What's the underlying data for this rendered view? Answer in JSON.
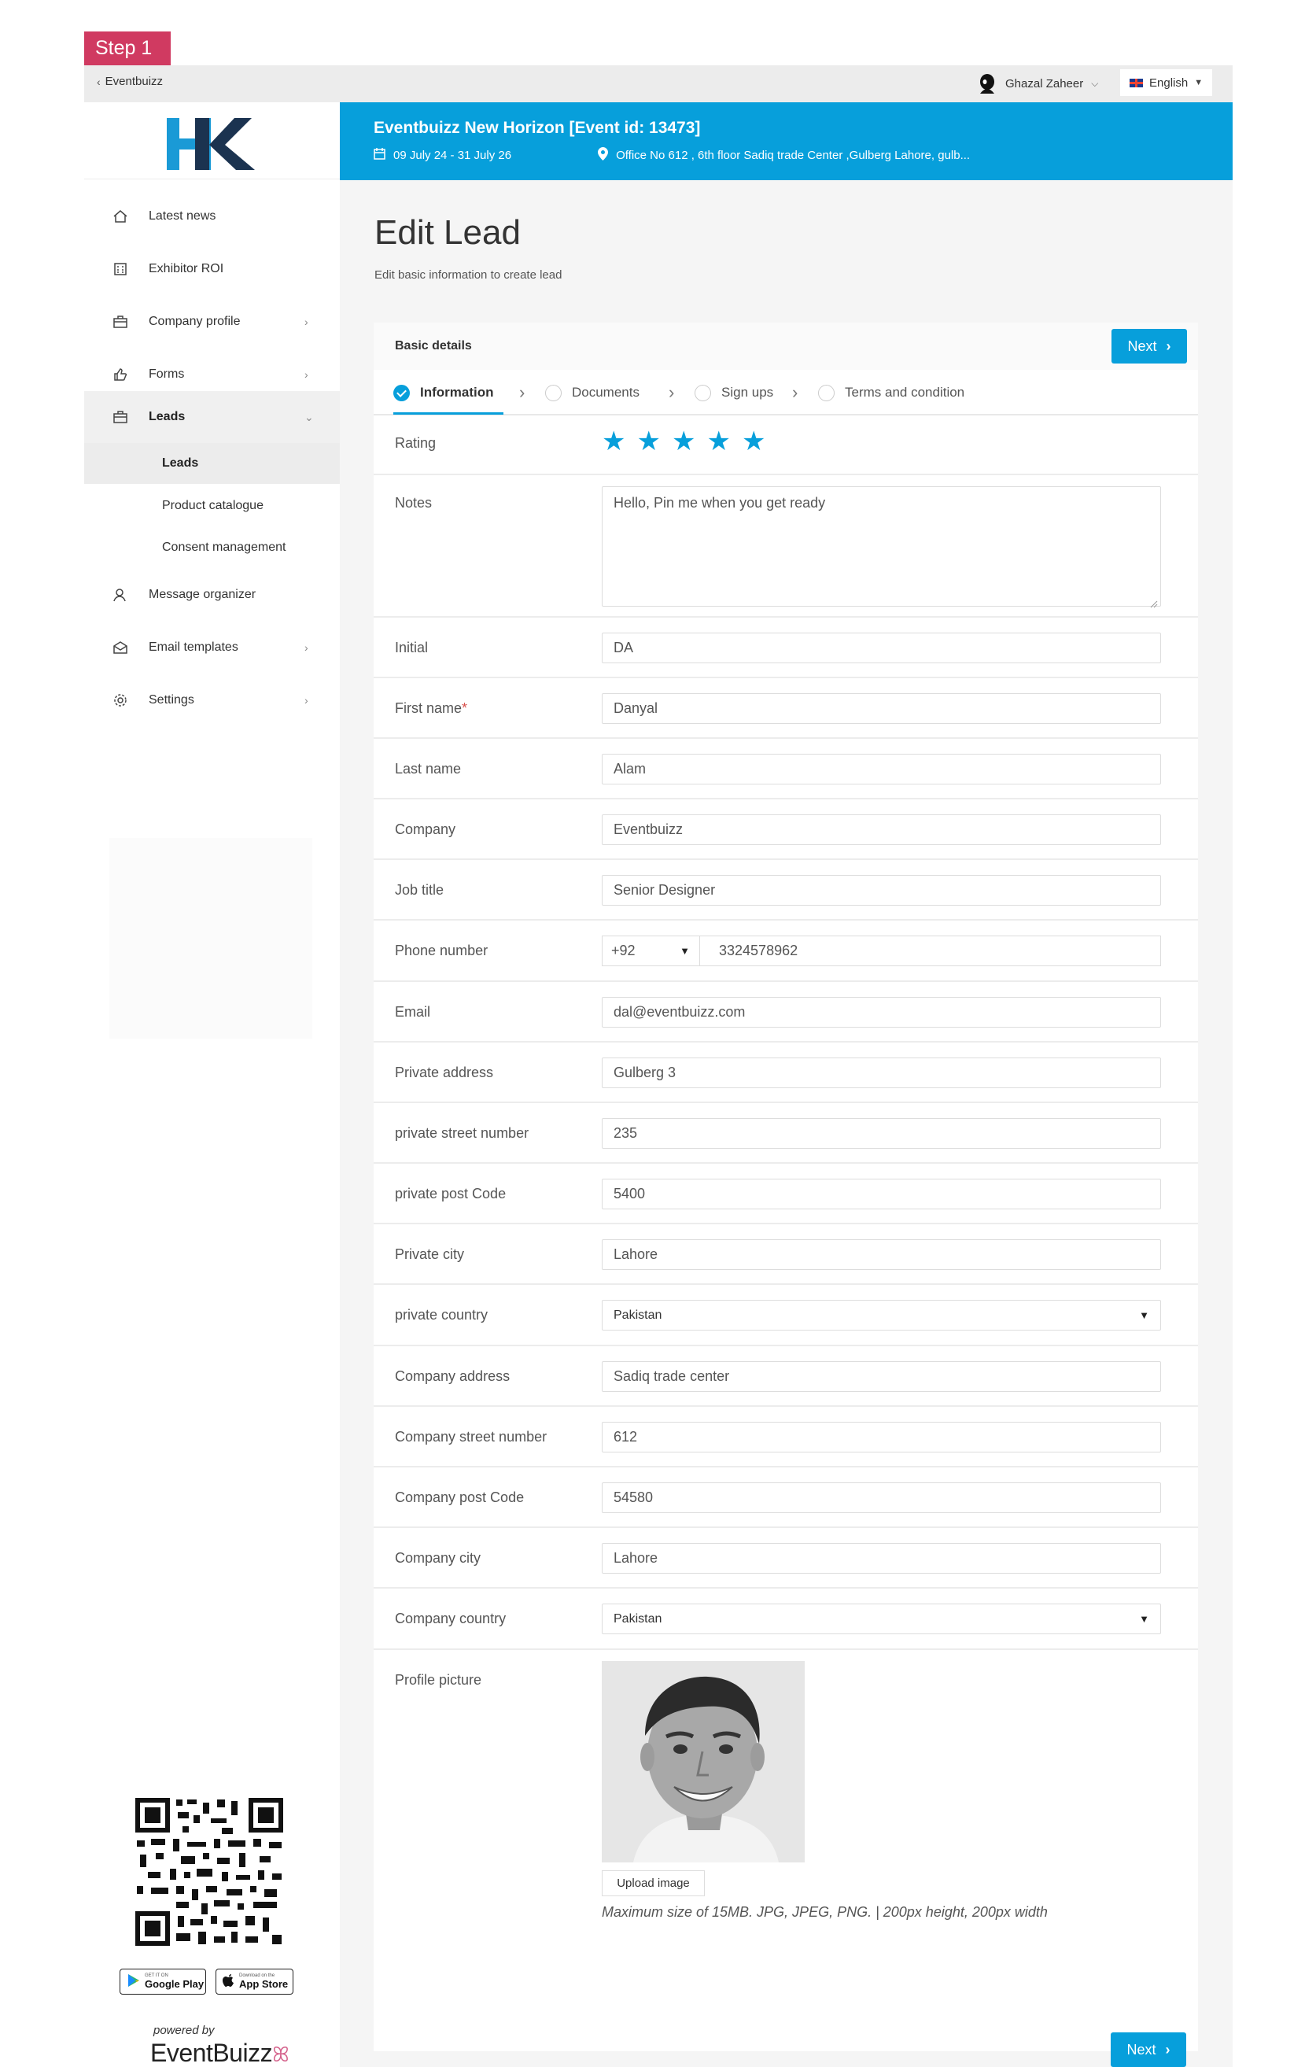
{
  "step_badge": "Step 1",
  "topbar": {
    "back_label": "Eventbuizz",
    "user_name": "Ghazal Zaheer",
    "language": "English"
  },
  "sidebar": {
    "nav": {
      "latest_news": "Latest news",
      "exhibitor_roi": "Exhibitor ROI",
      "company_profile": "Company profile",
      "forms": "Forms",
      "leads": "Leads",
      "message_organizer": "Message organizer",
      "email_templates": "Email templates",
      "settings": "Settings"
    },
    "sub": {
      "leads": "Leads",
      "product_catalogue": "Product catalogue",
      "consent_management": "Consent management"
    },
    "store": {
      "google_small": "GET IT ON",
      "google_big": "Google Play",
      "apple_small": "Download on the",
      "apple_big": "App Store"
    },
    "powered_by": "powered by",
    "brand": "EventBuizz"
  },
  "event": {
    "title": "Eventbuizz New Horizon [Event id: 13473]",
    "dates": "09 July 24 - 31 July 26",
    "location": "Office No 612 , 6th floor Sadiq trade Center ,Gulberg Lahore, gulb..."
  },
  "page": {
    "title": "Edit Lead",
    "subtitle": "Edit basic information to create lead"
  },
  "card": {
    "header_label": "Basic details",
    "next_label": "Next",
    "steps": [
      "Information",
      "Documents",
      "Sign ups",
      "Terms and condition"
    ]
  },
  "form": {
    "rating_label": "Rating",
    "rating_value": 5,
    "rating_max": 5,
    "notes_label": "Notes",
    "notes_value": "Hello,  Pin me when you get ready",
    "initial_label": "Initial",
    "initial_value": "DA",
    "first_name_label": "First name",
    "required_mark": "*",
    "first_name_value": "Danyal",
    "last_name_label": "Last name",
    "last_name_value": "Alam",
    "company_label": "Company",
    "company_value": "Eventbuizz",
    "job_title_label": "Job title",
    "job_title_value": "Senior Designer",
    "phone_label": "Phone number",
    "phone_code": "+92",
    "phone_value": "3324578962",
    "email_label": "Email",
    "email_value": "dal@eventbuizz.com",
    "private_address_label": "Private address",
    "private_address_value": "Gulberg 3",
    "private_street_label": "private street number",
    "private_street_value": "235",
    "private_post_label": "private post Code",
    "private_post_value": "5400",
    "private_city_label": "Private city",
    "private_city_value": "Lahore",
    "private_country_label": "private country",
    "private_country_value": "Pakistan",
    "company_address_label": "Company address",
    "company_address_value": "Sadiq trade center",
    "company_street_label": "Company street number",
    "company_street_value": "612",
    "company_post_label": "Company post Code",
    "company_post_value": "54580",
    "company_city_label": "Company city",
    "company_city_value": "Lahore",
    "company_country_label": "Company country",
    "company_country_value": "Pakistan",
    "profile_picture_label": "Profile picture",
    "upload_label": "Upload image",
    "upload_hint": "Maximum size of 15MB. JPG, JPEG, PNG.  |  200px height, 200px width"
  },
  "colors": {
    "accent": "#079fdb",
    "step_badge": "#d03a61",
    "required": "#d9534f"
  }
}
